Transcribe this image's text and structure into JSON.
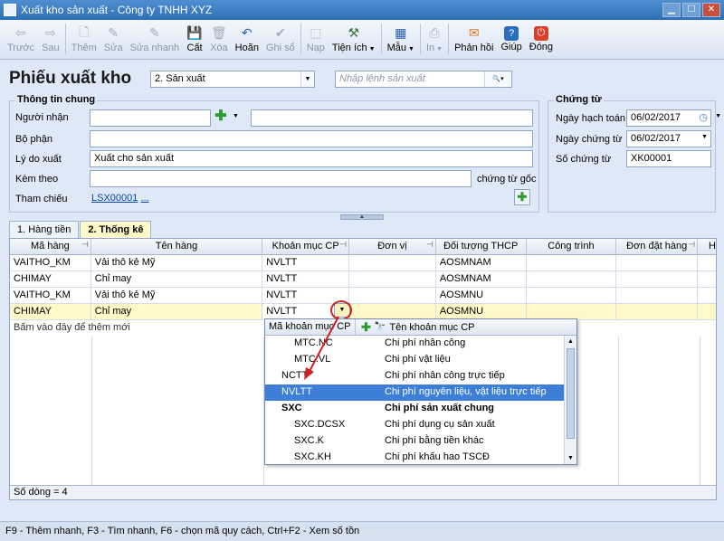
{
  "window": {
    "title": "Xuất kho sản xuất - Công ty TNHH XYZ"
  },
  "toolbar": {
    "prev": "Trước",
    "next": "Sau",
    "add": "Thêm",
    "edit": "Sửa",
    "quick_edit": "Sửa nhanh",
    "save": "Cất",
    "delete": "Xóa",
    "undo": "Hoãn",
    "post": "Ghi sổ",
    "load": "Nạp",
    "utilities": "Tiện ích",
    "template": "Mẫu",
    "print": "In",
    "feedback": "Phản hồi",
    "help": "Giúp",
    "close": "Đóng"
  },
  "header": {
    "page_title": "Phiếu xuất kho",
    "type_select": "2. Sản xuất",
    "search_placeholder": "Nhập lệnh sản xuất"
  },
  "general": {
    "legend": "Thông tin chung",
    "receiver_label": "Người nhận",
    "department_label": "Bộ phận",
    "reason_label": "Lý do xuất",
    "reason_value": "Xuất cho sản xuất",
    "attach_label": "Kèm theo",
    "attach_suffix": "chứng từ gốc",
    "reference_label": "Tham chiếu",
    "reference_value": "LSX00001",
    "reference_more": "..."
  },
  "voucher": {
    "legend": "Chứng từ",
    "accounting_date_label": "Ngày hạch toán",
    "accounting_date": "06/02/2017",
    "voucher_date_label": "Ngày chứng từ",
    "voucher_date": "06/02/2017",
    "voucher_no_label": "Số chứng từ",
    "voucher_no": "XK00001"
  },
  "tabs": [
    "1. Hàng tiền",
    "2. Thống kê"
  ],
  "grid": {
    "columns": [
      "Mã hàng",
      "Tên hàng",
      "Khoản mục CP",
      "Đơn vị",
      "Đối tượng THCP",
      "Công trình",
      "Đơn đặt hàng",
      "Hợ"
    ],
    "rows": [
      [
        "VAITHO_KM",
        "Vải thô kẻ Mỹ",
        "NVLTT",
        "",
        "AOSMNAM",
        "",
        ""
      ],
      [
        "CHIMAY",
        "Chỉ may",
        "NVLTT",
        "",
        "AOSMNAM",
        "",
        ""
      ],
      [
        "VAITHO_KM",
        "Vải thô kẻ Mỹ",
        "NVLTT",
        "",
        "AOSMNU",
        "",
        ""
      ],
      [
        "CHIMAY",
        "Chỉ may",
        "NVLTT",
        "",
        "AOSMNU",
        "",
        ""
      ]
    ],
    "add_row_hint": "Bấm vào đây để thêm mới",
    "row_count": "Số dòng = 4"
  },
  "popup": {
    "col1": "Mã khoản mục CP",
    "col2": "Tên khoản mục CP",
    "items": [
      [
        "MTC.NC",
        "Chi phí nhân công"
      ],
      [
        "MTC.VL",
        "Chi phí vật liệu"
      ],
      [
        "NCTT",
        "Chi phí nhân công trực tiếp"
      ],
      [
        "NVLTT",
        "Chi phí nguyên liệu, vật liệu trực tiếp"
      ],
      [
        "SXC",
        "Chi phí sản xuất chung"
      ],
      [
        "SXC.DCSX",
        "Chi phí dụng cụ sản xuất"
      ],
      [
        "SXC.K",
        "Chi phí bằng tiền khác"
      ],
      [
        "SXC.KH",
        "Chi phí khấu hao TSCĐ"
      ]
    ]
  },
  "statusbar": {
    "text": "F9 - Thêm nhanh, F3 - Tìm nhanh, F6 - chọn mã quy cách, Ctrl+F2 - Xem số tồn"
  },
  "colors": {
    "title_bar": "#2d6fb4",
    "selected_row": "#fff8c8",
    "popup_highlight": "#3d7fd6",
    "annotation": "#d02020"
  }
}
